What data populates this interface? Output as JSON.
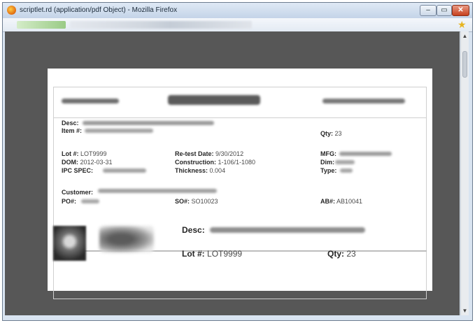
{
  "window": {
    "title": "scriptlet.rd (application/pdf Object) - Mozilla Firefox",
    "min_label": "–",
    "max_label": "▭",
    "close_label": "✕"
  },
  "icons": {
    "app": "firefox-icon",
    "bookmark": "star-icon",
    "scroll_up": "chevron-up-icon",
    "scroll_down": "chevron-down-icon"
  },
  "scroll": {
    "up": "▲",
    "down": "▼",
    "position": 0.12
  },
  "label": {
    "desc": "Desc:",
    "item": "Item #:",
    "qty_label": "Qty:",
    "qty_value": "23",
    "lot_label": "Lot #:",
    "lot_value": "LOT9999",
    "retest_label": "Re-test Date:",
    "retest_value": "9/30/2012",
    "mfg_label": "MFG:",
    "dom_label": "DOM:",
    "dom_value": "2012-03-31",
    "construction_label": "Construction:",
    "construction_value": "1-106/1-1080",
    "dim_label": "Dim:",
    "ipc_label": "IPC SPEC:",
    "thickness_label": "Thickness:",
    "thickness_value": "0.004",
    "type_label": "Type:",
    "customer_label": "Customer:",
    "po_label": "PO#:",
    "so_label": "SO#:",
    "so_value": "SO10023",
    "ab_label": "AB#:",
    "ab_value": "AB10041"
  },
  "bottom": {
    "desc_label": "Desc:",
    "lot_label": "Lot #:",
    "lot_value": "LOT9999",
    "qty_label": "Qty:",
    "qty_value": "23"
  },
  "colors": {
    "viewer_bg": "#575757",
    "close_button": "#c6401e",
    "url_site": "#9acb86"
  }
}
